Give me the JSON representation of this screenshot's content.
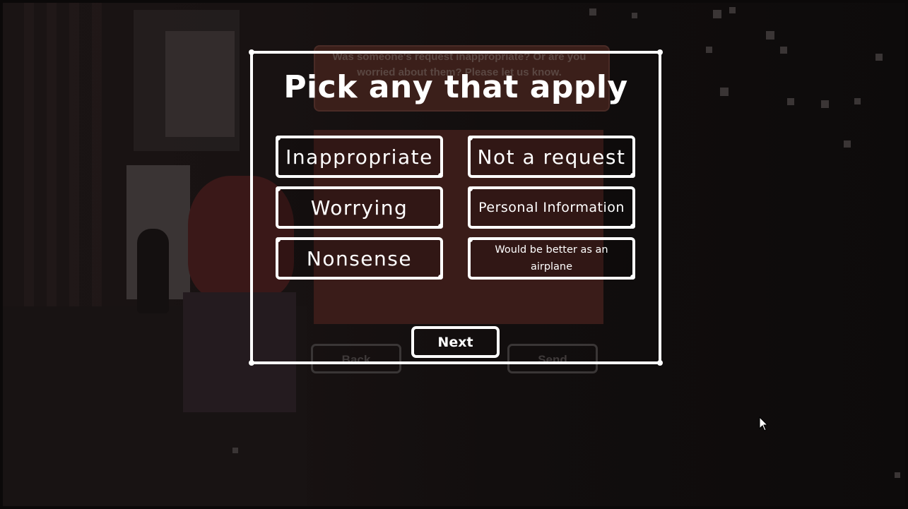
{
  "background": {
    "prompt_text": "Was someone's request inappropriate? Or are you worried about them? Please let us know.",
    "back_label": "Back",
    "send_label": "Send"
  },
  "dialog": {
    "title": "Pick any that apply",
    "options": [
      {
        "label": "Inappropriate"
      },
      {
        "label": "Not a request"
      },
      {
        "label": "Worrying"
      },
      {
        "label": "Personal Information"
      },
      {
        "label": "Nonsense"
      },
      {
        "label": "Would be better as an airplane"
      }
    ],
    "next_label": "Next"
  },
  "colors": {
    "dialog_border": "#ffffff",
    "background": "#0b0909",
    "paper": "#3a1c19"
  },
  "icons": {
    "cursor": "pointer-cursor-icon"
  }
}
